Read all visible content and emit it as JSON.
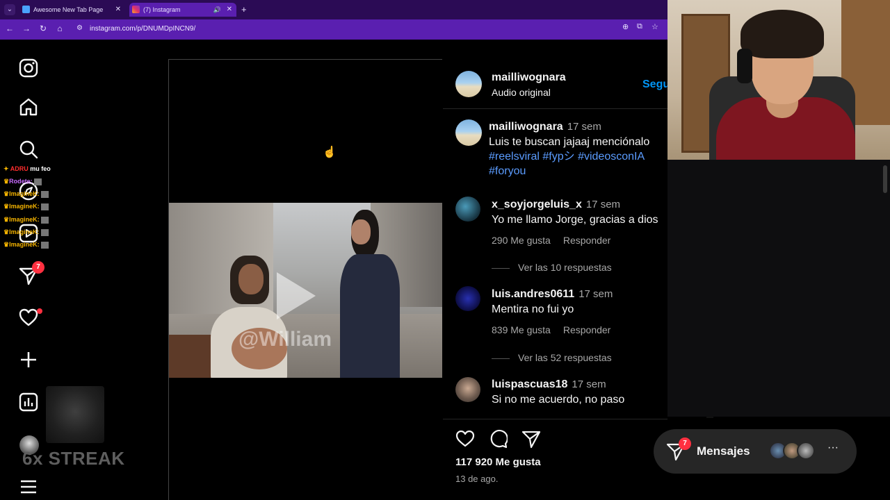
{
  "browser": {
    "tabs": [
      {
        "label": "Awesome New Tab Page"
      },
      {
        "label": "(7) Instagram"
      }
    ],
    "url": "instagram.com/p/DNUMDpINCN9/"
  },
  "sidebar": {
    "notifications_badge": "7",
    "streak_label": "6x STREAK"
  },
  "post": {
    "header_username": "mailliwognara",
    "header_sub": "Audio original",
    "follow_label": "Segu",
    "watermark": "@William",
    "caption": {
      "username": "mailliwognara",
      "time": "17 sem",
      "text": "Luis te buscan jajaaj menciónalo",
      "tags": [
        "#reelsviral",
        "#fypシ",
        "#videosconIA",
        "#foryou"
      ]
    },
    "comments": [
      {
        "username": "x_soyjorgeluis_x",
        "time": "17 sem",
        "text": "Yo me llamo Jorge, gracias a dios",
        "likes": "290 Me gusta",
        "reply": "Responder",
        "replies": "Ver las 10 respuestas"
      },
      {
        "username": "luis.andres0611",
        "time": "17 sem",
        "text": "Mentira no fui yo",
        "likes": "839 Me gusta",
        "reply": "Responder",
        "replies": "Ver las 52 respuestas"
      },
      {
        "username": "luispascuas18",
        "time": "17 sem",
        "text": "Si no me acuerdo, no paso"
      }
    ],
    "likes_total": "117 920 Me gusta",
    "date": "13 de ago."
  },
  "chat": {
    "lines": [
      {
        "user": "ADRU",
        "msg": "mu feo",
        "color": "#ff2d2d"
      },
      {
        "user": "Rodete:",
        "msg": "",
        "color": "#c86bff"
      },
      {
        "user": "ImagineK:",
        "msg": "",
        "color": "#f5b400"
      },
      {
        "user": "ImagineK:",
        "msg": "",
        "color": "#f5b400"
      },
      {
        "user": "ImagineK:",
        "msg": "",
        "color": "#f5b400"
      },
      {
        "user": "ImagineK:",
        "msg": "",
        "color": "#f5b400"
      },
      {
        "user": "ImagineK:",
        "msg": "",
        "color": "#f5b400"
      }
    ]
  },
  "messages": {
    "label": "Mensajes",
    "badge": "7"
  }
}
